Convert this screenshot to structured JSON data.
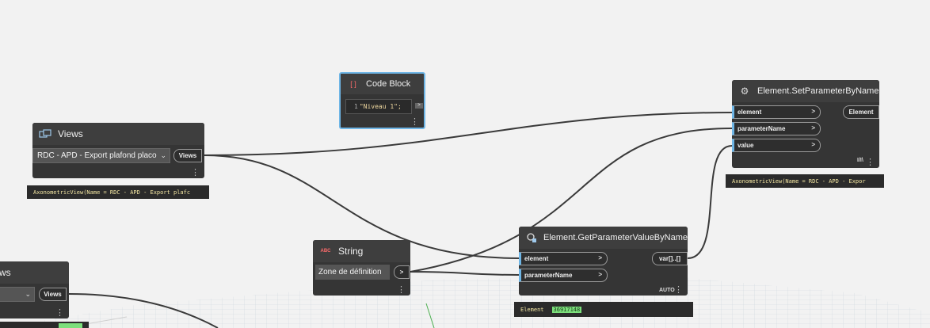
{
  "nodes": {
    "code_block": {
      "title": "Code Block",
      "icon": "code-block-icon",
      "line_number": "1",
      "code": "\"Niveau 1\";",
      "output_arrow": ">"
    },
    "views_main": {
      "title": "Views",
      "icon": "views-icon",
      "selected": "RDC - APD -  Export plafond placo",
      "output": "Views",
      "preview": "AxonometricView(Name = RDC - APD -  Export plafc"
    },
    "views_partial": {
      "title": "ws",
      "output": "Views"
    },
    "string_node": {
      "title": "String",
      "icon_text": "ABC",
      "value": "Zone de définition",
      "output_arrow": ">"
    },
    "set_param": {
      "title": "Element.SetParameterByName",
      "icon": "gear-icon",
      "inputs": [
        "element",
        "parameterName",
        "value"
      ],
      "output": "Element",
      "lacing": "I/I\\",
      "preview": "AxonometricView(Name = RDC - APD -  Expor"
    },
    "get_param": {
      "title": "Element.GetParameterValueByName",
      "icon": "get-parameter-icon",
      "inputs": [
        "element",
        "parameterName"
      ],
      "output": "var[]..[]",
      "lacing": "AUTO",
      "preview_label": "Element",
      "preview_value": "36917148"
    }
  },
  "port_arrow": ">",
  "colors": {
    "canvas": "#f2f2f2",
    "node_body": "#353535",
    "node_header": "#3e3e3e",
    "selected_border": "#6fb6e6",
    "wire": "#3a3a3a",
    "preview_text": "#f4e7a3",
    "preview_value_bg": "#7ce07c"
  }
}
